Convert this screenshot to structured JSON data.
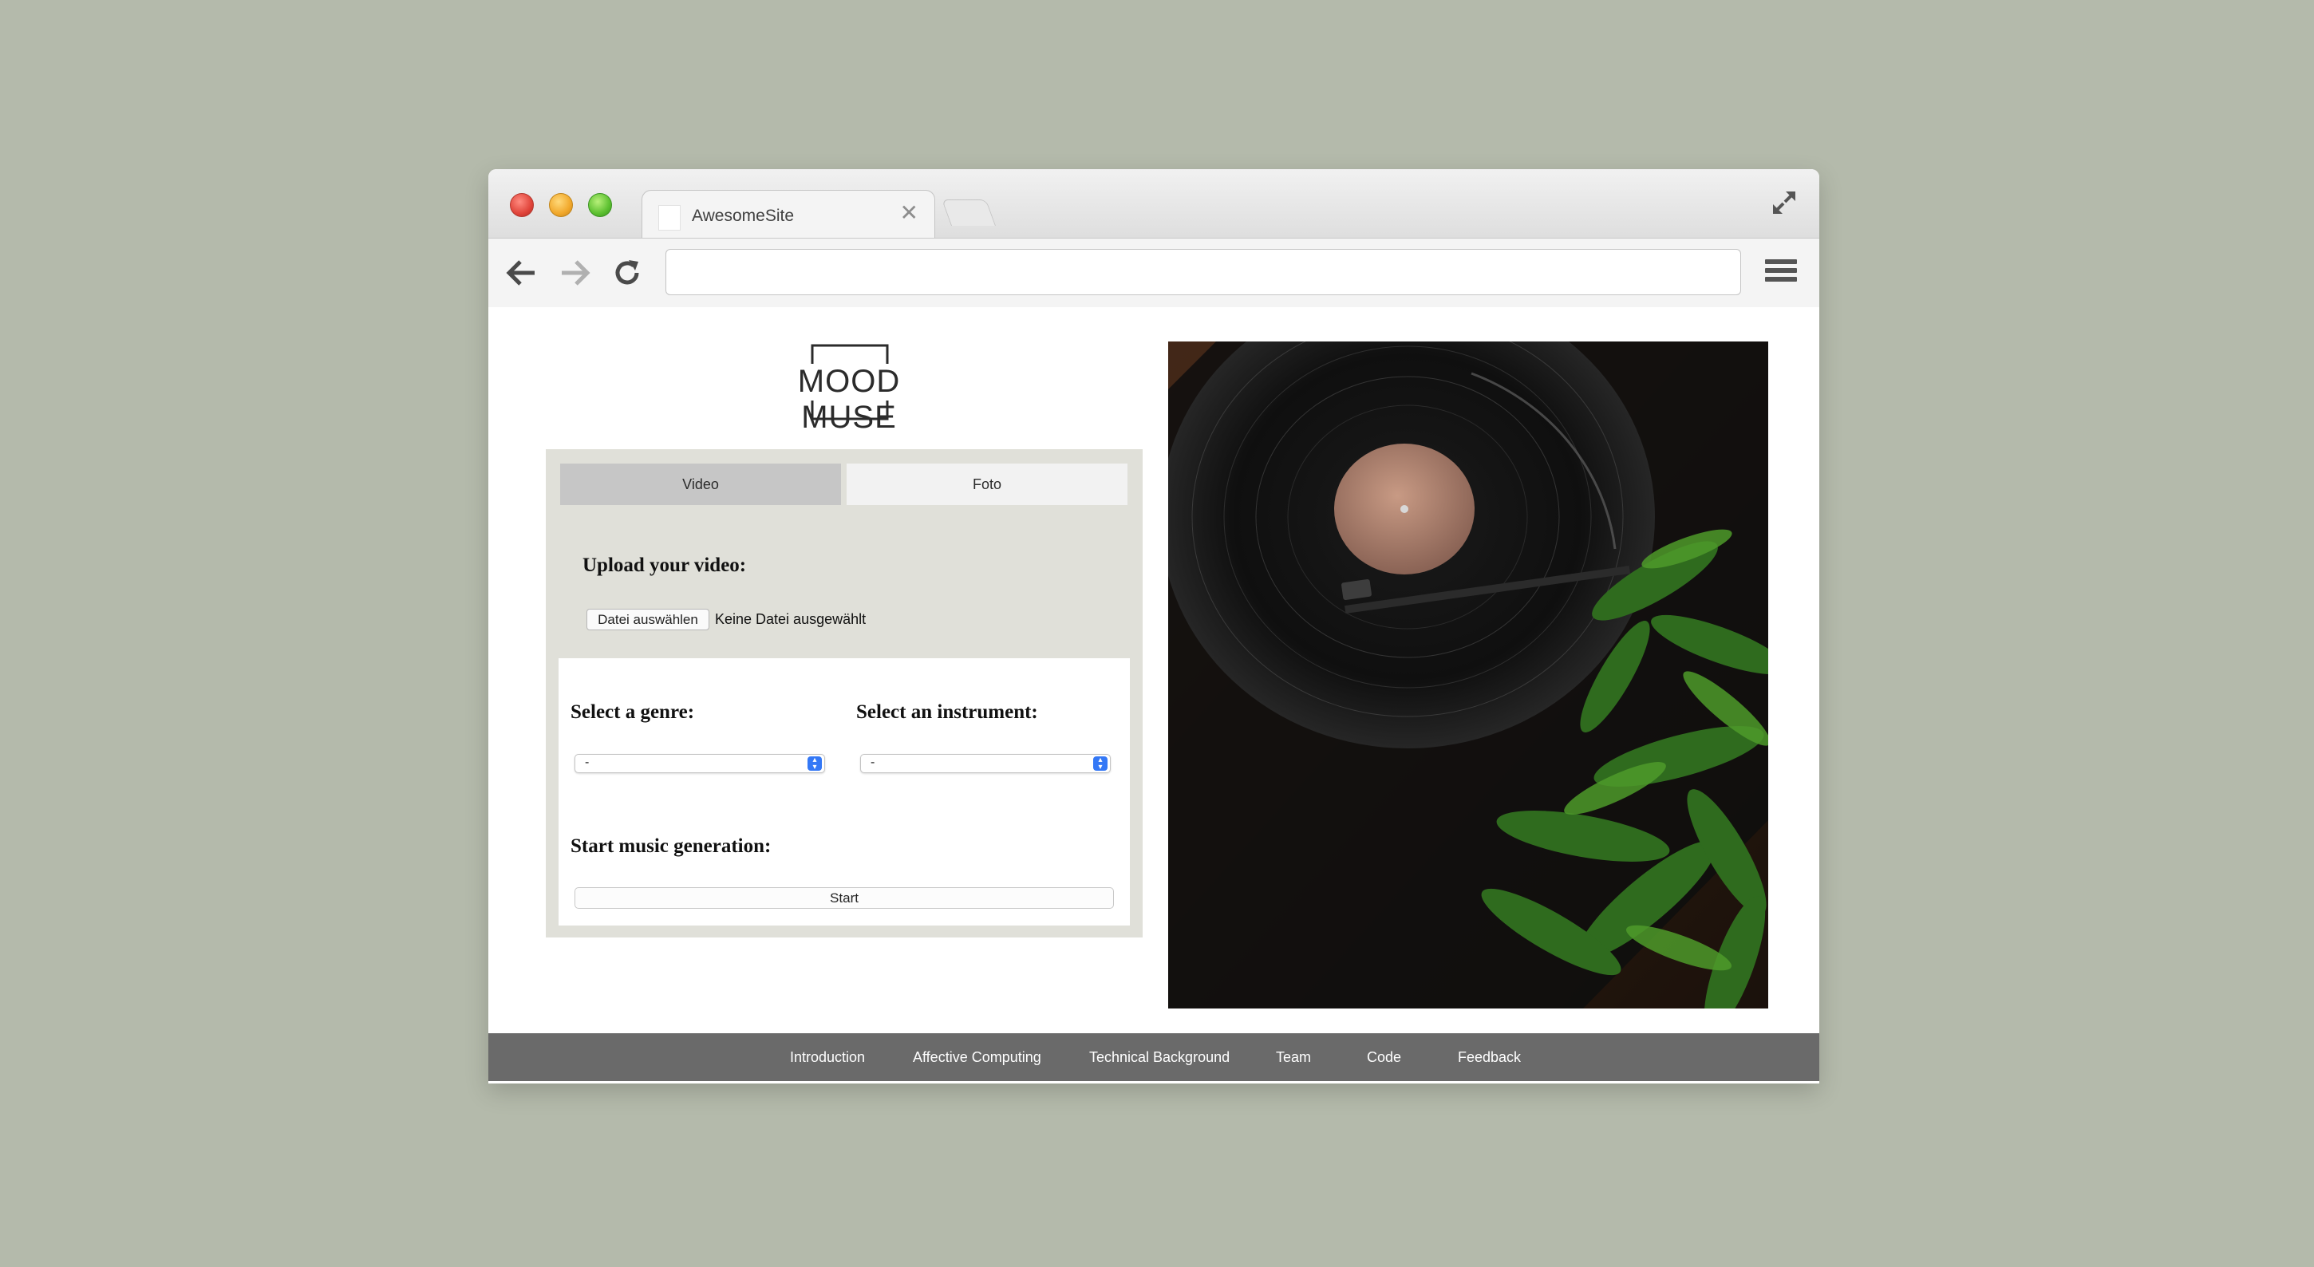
{
  "browser": {
    "tab_title": "AwesomeSite",
    "tab_close": "✕",
    "address_value": ""
  },
  "logo": {
    "text": "MOOD MUSE"
  },
  "mode_tabs": {
    "video": "Video",
    "foto": "Foto",
    "active": "Video"
  },
  "upload": {
    "title": "Upload your video:",
    "button_label": "Datei auswählen",
    "status": "Keine Datei ausgewählt"
  },
  "genre": {
    "label": "Select a genre:",
    "selected": "-"
  },
  "instrument": {
    "label": "Select an instrument:",
    "selected": "-"
  },
  "generation": {
    "label": "Start music generation:",
    "button_label": "Start"
  },
  "footer": {
    "links": [
      "Introduction",
      "Affective Computing",
      "Technical Background",
      "Team",
      "Code",
      "Feedback"
    ]
  },
  "colors": {
    "page_background": "#b4baab",
    "panel_background": "#e0e0d9",
    "active_tab": "#c6c6c6",
    "inactive_tab": "#f2f2f2",
    "footer_background": "#6a6a6a",
    "select_accent": "#3478f6"
  },
  "icons": {
    "back": "arrow-left-icon",
    "forward": "arrow-right-icon",
    "reload": "reload-icon",
    "menu": "hamburger-menu-icon",
    "expand": "expand-icon",
    "select_arrow": "updown-chevron-icon"
  },
  "photo": {
    "subject": "turntable-photo"
  }
}
